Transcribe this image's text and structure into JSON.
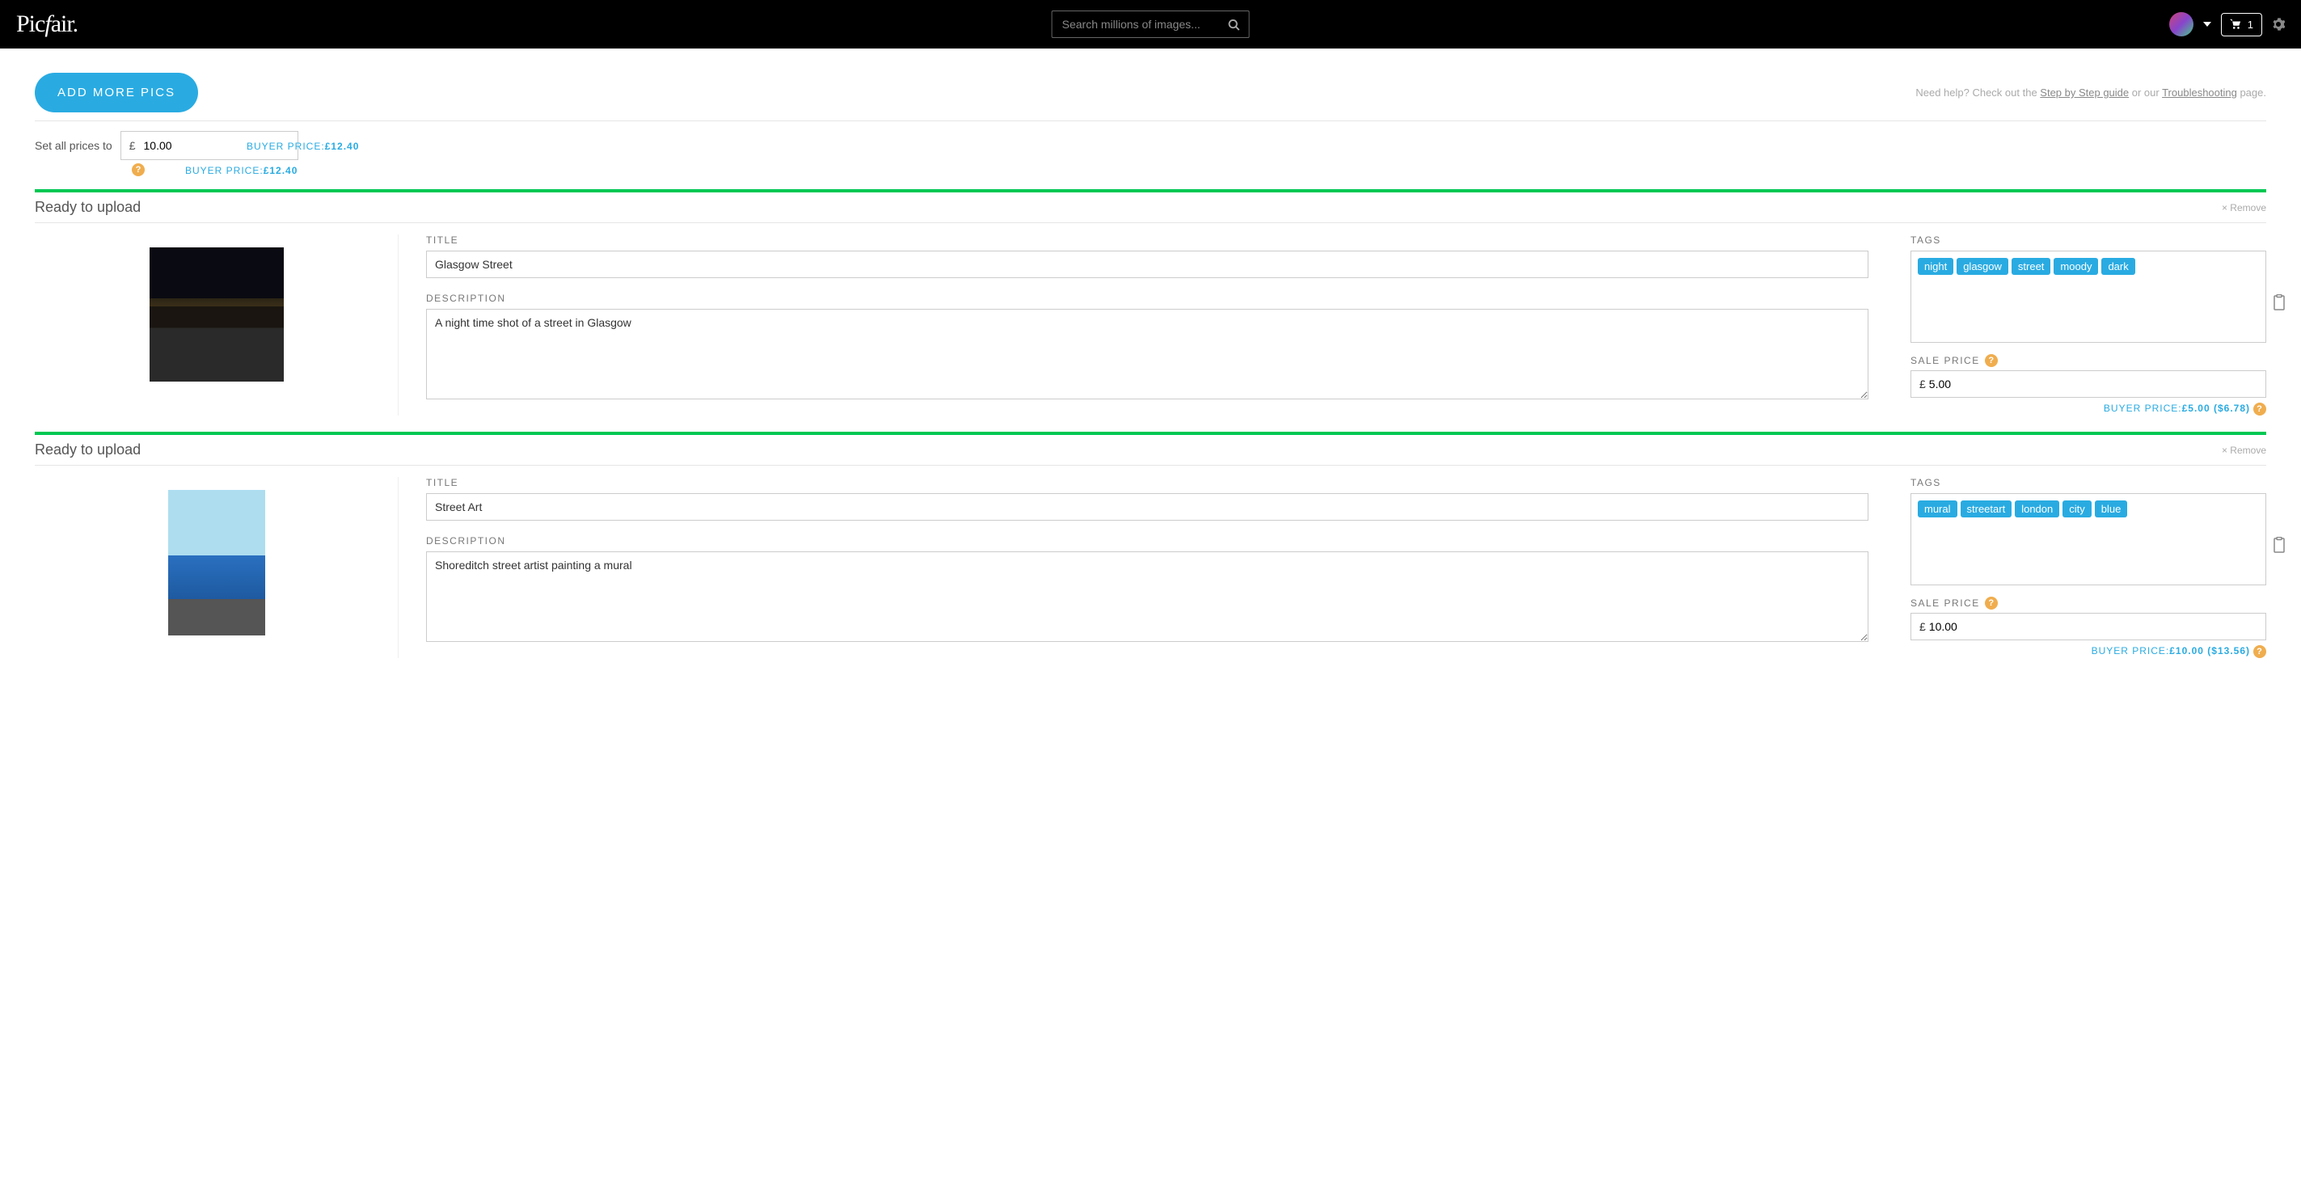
{
  "header": {
    "logo_prefix": "Pic",
    "logo_italic": "f",
    "logo_suffix": "air.",
    "search_placeholder": "Search millions of images...",
    "cart_count": "1"
  },
  "top": {
    "add_more_label": "ADD MORE PICS",
    "help_prefix": "Need help? Check out the ",
    "help_link1": "Step by Step guide",
    "help_mid": " or our ",
    "help_link2": "Troubleshooting",
    "help_suffix": " page."
  },
  "priceAll": {
    "label": "Set all prices to",
    "currency": "£",
    "value": "10.00",
    "buyer_label": "BUYER PRICE:",
    "buyer_value": "£12.40"
  },
  "labels": {
    "ready": "Ready to upload",
    "remove": "× Remove",
    "title": "TITLE",
    "description": "DESCRIPTION",
    "tags": "TAGS",
    "sale_price": "SALE PRICE",
    "buyer_price": "BUYER PRICE:"
  },
  "items": [
    {
      "title": "Glasgow Street",
      "description": "A night time shot of a street in Glasgow",
      "tags": [
        "night",
        "glasgow",
        "street",
        "moody",
        "dark"
      ],
      "currency": "£",
      "sale_price": "5.00",
      "buyer_price": "£5.00",
      "buyer_price_alt": "($6.78)",
      "thumb_css": "linear-gradient(180deg,#0a0a12 0%,#0a0a12 38%,#2b2416 38%,#3a2e18 44%,#1a1510 44%,#1a1510 60%,#2a2a2a 60%,#2a2a2a 100%),radial-gradient(circle at 30% 50%,#f5e6a0 0%,transparent 8%),radial-gradient(circle at 55% 48%,#d84 0%,transparent 10%)",
      "thumb_class": ""
    },
    {
      "title": "Street Art",
      "description": "Shoreditch street artist painting a mural",
      "tags": [
        "mural",
        "streetart",
        "london",
        "city",
        "blue"
      ],
      "currency": "£",
      "sale_price": "10.00",
      "buyer_price": "£10.00",
      "buyer_price_alt": "($13.56)",
      "thumb_css": "linear-gradient(180deg,#aeddf0 0%,#aeddf0 45%,#2a70c0 45%,#1e5aa0 75%,#555 75%,#555 100%),linear-gradient(180deg,transparent 10%,#999 10%,#999 44%,transparent 44%)",
      "thumb_class": "portrait"
    }
  ]
}
